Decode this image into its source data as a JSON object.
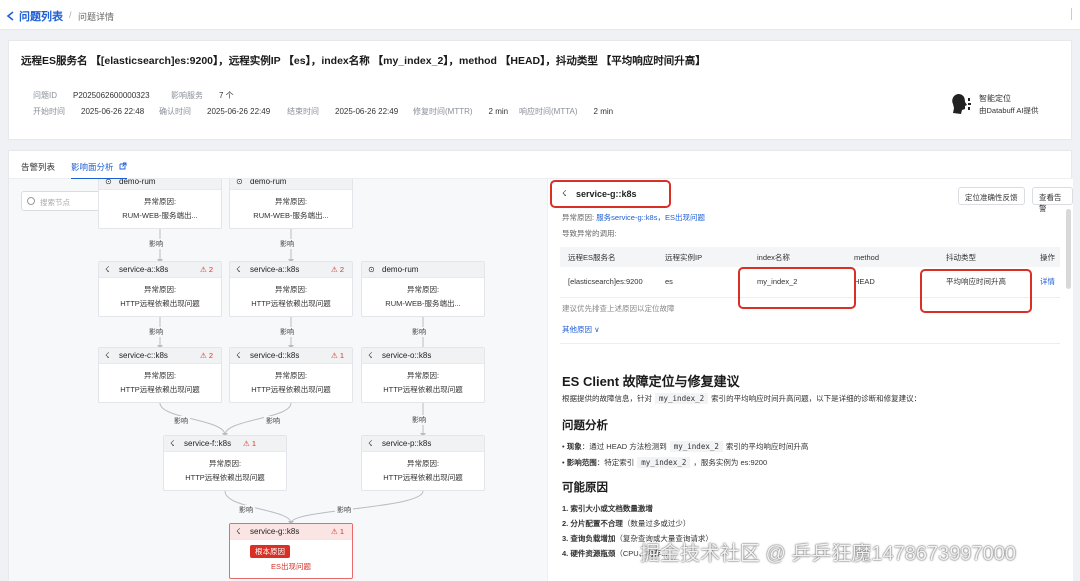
{
  "breadcrumb": {
    "list": "问题列表",
    "detail": "问题详情",
    "sep": "/"
  },
  "summary": {
    "title": "远程ES服务名 【[elasticsearch]es:9200】，远程实例IP 【es】，index名称 【my_index_2】，method 【HEAD】，抖动类型 【平均响应时间升高】",
    "id_label": "问题ID",
    "id_value": "P2025062600000323",
    "svc_label": "影响服务",
    "svc_value": "7 个",
    "start_label": "开始时间",
    "start_value": "2025-06-26 22:48",
    "confirm_label": "确认时间",
    "confirm_value": "2025-06-26 22:49",
    "end_label": "结束时间",
    "end_value": "2025-06-26 22:49",
    "mttr_label": "修复时间(MTTR)",
    "mttr_value": "2 min",
    "mtta_label": "响应时间(MTTA)",
    "mtta_value": "2 min",
    "ai_line1": "智能定位",
    "ai_line2": "由Databuff AI提供"
  },
  "tabs": {
    "alerts": "告警列表",
    "impact": "影响面分析"
  },
  "graph": {
    "search_placeholder": "搜索节点",
    "edge_label": "影响",
    "cause_label": "异常原因:",
    "nodes": [
      {
        "name": "demo-rum",
        "reason": "RUM-WEB-服务端出..."
      },
      {
        "name": "demo-rum",
        "reason": "RUM-WEB-服务端出..."
      },
      {
        "name": "service-a::k8s",
        "count": "2",
        "reason": "HTTP远程依赖出现问题"
      },
      {
        "name": "service-a::k8s",
        "count": "2",
        "reason": "HTTP远程依赖出现问题"
      },
      {
        "name": "demo-rum",
        "reason": "RUM-WEB-服务端出..."
      },
      {
        "name": "service-c::k8s",
        "count": "2",
        "reason": "HTTP远程依赖出现问题"
      },
      {
        "name": "service-d::k8s",
        "count": "1",
        "reason": "HTTP远程依赖出现问题"
      },
      {
        "name": "service-o::k8s",
        "reason": "HTTP远程依赖出现问题"
      },
      {
        "name": "service-f::k8s",
        "count": "1",
        "reason": "HTTP远程依赖出现问题"
      },
      {
        "name": "service-p::k8s",
        "reason": "HTTP远程依赖出现问题"
      },
      {
        "name": "service-g::k8s",
        "count": "1",
        "badge": "根本原因",
        "reason": "ES出现问题"
      }
    ]
  },
  "detail": {
    "service": "service-g::k8s",
    "btn_feedback": "定位准确性反馈",
    "btn_alerts": "查看告警",
    "cause_prefix": "异常原因:",
    "cause_link": "服务service-g::k8s，ES出现问题",
    "calls_label": "导致异常的调用:",
    "table": {
      "headers": [
        "远程ES服务名",
        "远程实例IP",
        "index名称",
        "method",
        "抖动类型",
        "操作"
      ],
      "row": [
        "[elasticsearch]es:9200",
        "es",
        "my_index_2",
        "HEAD",
        "平均响应时间升高",
        "详情"
      ]
    },
    "advice": "建议优先排查上述原因以定位故障",
    "other": "其他原因 ∨",
    "h_main": "ES Client 故障定位与修复建议",
    "intro_pre": "根据提供的故障信息，针对",
    "intro_code": "my_index_2",
    "intro_post": "索引的平均响应时间升高问题，以下是详细的诊断和修复建议：",
    "h_analysis": "问题分析",
    "b1_label": "现象",
    "b1_pre": "：通过 HEAD 方法检测到",
    "b1_code": "my_index_2",
    "b1_post": "索引的平均响应时间升高",
    "b2_label": "影响范围",
    "b2_pre": "：特定索引",
    "b2_code": "my_index_2",
    "b2_post": "，服务实例为 es:9200",
    "h_causes": "可能原因",
    "c1": "1. 索引大小或文档数量激增",
    "c2_strong": "2. 分片配置不合理",
    "c2_rest": "（数量过多或过少）",
    "c3_strong": "3. 查询负载增加",
    "c3_rest": "（复杂查询或大量查询请求）",
    "c4_strong": "4. 硬件资源瓶颈",
    "c4_rest": "（CPU、内存..."
  },
  "watermark": "掘金技术社区 @ 乒乒狂魔1478673997000",
  "colors": {
    "accent": "#1f5fd6",
    "alert": "#d93026"
  }
}
